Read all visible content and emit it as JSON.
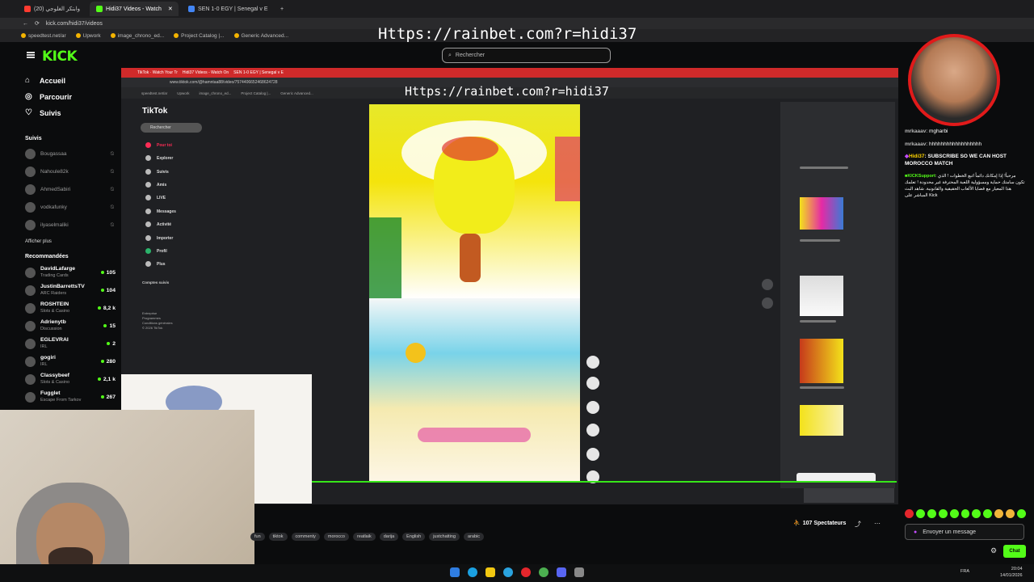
{
  "browser": {
    "tabs": [
      {
        "label": "وابتكر الغلوجي (20)"
      },
      {
        "label": "Hidi37 Videos - Watch"
      },
      {
        "label": "SEN 1-0 EGY | Senegal v E"
      }
    ],
    "url": "kick.com/hidi37/videos",
    "bookmarks": [
      "speedtest.net/ar",
      "Upwork",
      "image_chrono_ed...",
      "Project Catalog |...",
      "Generic Advanced..."
    ]
  },
  "promo_text": "Https://rainbet.com?r=hidi37",
  "kick": {
    "logo": "KICK",
    "search_placeholder": "Rechercher",
    "nav": [
      "Accueil",
      "Parcourir",
      "Suivis"
    ],
    "followed_title": "Suivis",
    "followed": [
      "Bougassaa",
      "Nahoule82k",
      "AhmedSabiri",
      "vodkafunky",
      "ilyaselmaliki"
    ],
    "show_more": "Afficher plus",
    "recommended_title": "Recommandées",
    "recommended": [
      {
        "name": "DavidLafarge",
        "category": "Trading Cards",
        "viewers": "105"
      },
      {
        "name": "JustinBarrettsTV",
        "category": "ARC Raiders",
        "viewers": "104"
      },
      {
        "name": "ROSHTEIN",
        "category": "Slots & Casino",
        "viewers": "8,2 k"
      },
      {
        "name": "Adrienytb",
        "category": "Discussion",
        "viewers": "15"
      },
      {
        "name": "EGLEVRAI",
        "category": "IRL",
        "viewers": "2"
      },
      {
        "name": "gogiri",
        "category": "IRL",
        "viewers": "280"
      },
      {
        "name": "Classybeef",
        "category": "Slots & Casino",
        "viewers": "2,1 k"
      },
      {
        "name": "Fugglet",
        "category": "Escape From Tarkov",
        "viewers": "267"
      }
    ],
    "viewer_count": "107 Spectateurs",
    "tags": [
      "fun",
      "tiktok",
      "commenty",
      "morocco",
      "reatlaik",
      "darija",
      "English",
      "justchatting",
      "arabic"
    ]
  },
  "inner_browser": {
    "url": "www.tiktok.com/@hamntaa88/video/7574406652468624728",
    "tiktok_logo": "TikTok",
    "search": "Rechercher",
    "menu": [
      "Pour toi",
      "Explorer",
      "Suivis",
      "Amis",
      "LIVE",
      "Messages",
      "Activité",
      "Importer",
      "Profil",
      "Plus"
    ],
    "following_title": "Comptes suivis",
    "footer": [
      "Entreprise",
      "Programmes",
      "Conditions générales",
      "© 2026 TikTok"
    ]
  },
  "chat": {
    "messages": [
      {
        "user": "mrkaaav",
        "text": "mgharbi",
        "user_color": "#b7b7b7"
      },
      {
        "user": "mrkaaav",
        "text": "hhhhhhhhhhhhhhhhhh",
        "user_color": "#b7b7b7"
      },
      {
        "user": "Hidi37",
        "text": "SUBSCRIBE SO WE CAN HOST MOROCCO MATCH",
        "user_color": "#ffd400"
      },
      {
        "user": "KICKSupport",
        "text": "مرحباً! إذا إمكانك دائماً اتبع الخطوات ! الذي تكون سامتك حماية ومسؤولية اللعبة المحترفة غير محدودة ! تعلمك هذا المعيار مع قضايا الألعاب الحقيقية والقانونية. شاهد البث المباشر على Kick",
        "user_color": "#53fc18"
      }
    ],
    "input_placeholder": "Envoyer un message",
    "send_label": "Chat"
  },
  "system": {
    "time": "20:04",
    "date": "14/01/2026",
    "lang": "FRA"
  },
  "colors": {
    "kick_green": "#53fc18",
    "bg": "#0b0c0d",
    "accent_red": "#e11a1a"
  }
}
